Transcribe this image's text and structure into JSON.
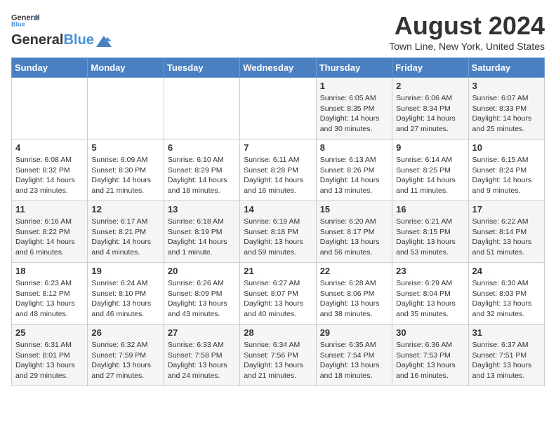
{
  "header": {
    "logo_line1": "General",
    "logo_line2": "Blue",
    "month": "August 2024",
    "location": "Town Line, New York, United States"
  },
  "weekdays": [
    "Sunday",
    "Monday",
    "Tuesday",
    "Wednesday",
    "Thursday",
    "Friday",
    "Saturday"
  ],
  "weeks": [
    [
      {
        "day": "",
        "content": ""
      },
      {
        "day": "",
        "content": ""
      },
      {
        "day": "",
        "content": ""
      },
      {
        "day": "",
        "content": ""
      },
      {
        "day": "1",
        "content": "Sunrise: 6:05 AM\nSunset: 8:35 PM\nDaylight: 14 hours\nand 30 minutes."
      },
      {
        "day": "2",
        "content": "Sunrise: 6:06 AM\nSunset: 8:34 PM\nDaylight: 14 hours\nand 27 minutes."
      },
      {
        "day": "3",
        "content": "Sunrise: 6:07 AM\nSunset: 8:33 PM\nDaylight: 14 hours\nand 25 minutes."
      }
    ],
    [
      {
        "day": "4",
        "content": "Sunrise: 6:08 AM\nSunset: 8:32 PM\nDaylight: 14 hours\nand 23 minutes."
      },
      {
        "day": "5",
        "content": "Sunrise: 6:09 AM\nSunset: 8:30 PM\nDaylight: 14 hours\nand 21 minutes."
      },
      {
        "day": "6",
        "content": "Sunrise: 6:10 AM\nSunset: 8:29 PM\nDaylight: 14 hours\nand 18 minutes."
      },
      {
        "day": "7",
        "content": "Sunrise: 6:11 AM\nSunset: 8:28 PM\nDaylight: 14 hours\nand 16 minutes."
      },
      {
        "day": "8",
        "content": "Sunrise: 6:13 AM\nSunset: 8:26 PM\nDaylight: 14 hours\nand 13 minutes."
      },
      {
        "day": "9",
        "content": "Sunrise: 6:14 AM\nSunset: 8:25 PM\nDaylight: 14 hours\nand 11 minutes."
      },
      {
        "day": "10",
        "content": "Sunrise: 6:15 AM\nSunset: 8:24 PM\nDaylight: 14 hours\nand 9 minutes."
      }
    ],
    [
      {
        "day": "11",
        "content": "Sunrise: 6:16 AM\nSunset: 8:22 PM\nDaylight: 14 hours\nand 6 minutes."
      },
      {
        "day": "12",
        "content": "Sunrise: 6:17 AM\nSunset: 8:21 PM\nDaylight: 14 hours\nand 4 minutes."
      },
      {
        "day": "13",
        "content": "Sunrise: 6:18 AM\nSunset: 8:19 PM\nDaylight: 14 hours\nand 1 minute."
      },
      {
        "day": "14",
        "content": "Sunrise: 6:19 AM\nSunset: 8:18 PM\nDaylight: 13 hours\nand 59 minutes."
      },
      {
        "day": "15",
        "content": "Sunrise: 6:20 AM\nSunset: 8:17 PM\nDaylight: 13 hours\nand 56 minutes."
      },
      {
        "day": "16",
        "content": "Sunrise: 6:21 AM\nSunset: 8:15 PM\nDaylight: 13 hours\nand 53 minutes."
      },
      {
        "day": "17",
        "content": "Sunrise: 6:22 AM\nSunset: 8:14 PM\nDaylight: 13 hours\nand 51 minutes."
      }
    ],
    [
      {
        "day": "18",
        "content": "Sunrise: 6:23 AM\nSunset: 8:12 PM\nDaylight: 13 hours\nand 48 minutes."
      },
      {
        "day": "19",
        "content": "Sunrise: 6:24 AM\nSunset: 8:10 PM\nDaylight: 13 hours\nand 46 minutes."
      },
      {
        "day": "20",
        "content": "Sunrise: 6:26 AM\nSunset: 8:09 PM\nDaylight: 13 hours\nand 43 minutes."
      },
      {
        "day": "21",
        "content": "Sunrise: 6:27 AM\nSunset: 8:07 PM\nDaylight: 13 hours\nand 40 minutes."
      },
      {
        "day": "22",
        "content": "Sunrise: 6:28 AM\nSunset: 8:06 PM\nDaylight: 13 hours\nand 38 minutes."
      },
      {
        "day": "23",
        "content": "Sunrise: 6:29 AM\nSunset: 8:04 PM\nDaylight: 13 hours\nand 35 minutes."
      },
      {
        "day": "24",
        "content": "Sunrise: 6:30 AM\nSunset: 8:03 PM\nDaylight: 13 hours\nand 32 minutes."
      }
    ],
    [
      {
        "day": "25",
        "content": "Sunrise: 6:31 AM\nSunset: 8:01 PM\nDaylight: 13 hours\nand 29 minutes."
      },
      {
        "day": "26",
        "content": "Sunrise: 6:32 AM\nSunset: 7:59 PM\nDaylight: 13 hours\nand 27 minutes."
      },
      {
        "day": "27",
        "content": "Sunrise: 6:33 AM\nSunset: 7:58 PM\nDaylight: 13 hours\nand 24 minutes."
      },
      {
        "day": "28",
        "content": "Sunrise: 6:34 AM\nSunset: 7:56 PM\nDaylight: 13 hours\nand 21 minutes."
      },
      {
        "day": "29",
        "content": "Sunrise: 6:35 AM\nSunset: 7:54 PM\nDaylight: 13 hours\nand 18 minutes."
      },
      {
        "day": "30",
        "content": "Sunrise: 6:36 AM\nSunset: 7:53 PM\nDaylight: 13 hours\nand 16 minutes."
      },
      {
        "day": "31",
        "content": "Sunrise: 6:37 AM\nSunset: 7:51 PM\nDaylight: 13 hours\nand 13 minutes."
      }
    ]
  ]
}
